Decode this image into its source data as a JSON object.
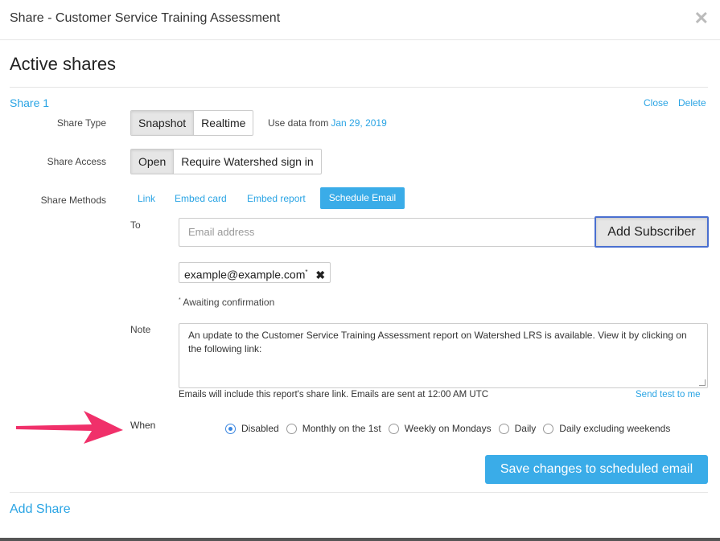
{
  "modal": {
    "title": "Share - Customer Service Training Assessment",
    "close_glyph": "✕"
  },
  "section_title": "Active shares",
  "share": {
    "name": "Share 1",
    "close_label": "Close",
    "delete_label": "Delete",
    "share_type": {
      "label": "Share Type",
      "options": [
        "Snapshot",
        "Realtime"
      ],
      "selected": "Snapshot",
      "date_prefix": "Use data from",
      "date_value": "Jan 29, 2019"
    },
    "share_access": {
      "label": "Share Access",
      "options": [
        "Open",
        "Require Watershed sign in"
      ],
      "selected": "Open"
    },
    "share_methods": {
      "label": "Share Methods",
      "items": [
        "Link",
        "Embed card",
        "Embed report",
        "Schedule Email"
      ],
      "active": "Schedule Email"
    },
    "to": {
      "label": "To",
      "placeholder": "Email address",
      "add_button": "Add Subscriber",
      "subscriber": "example@example.com",
      "subscriber_mark": "*",
      "awaiting_mark": "*",
      "awaiting_text": "Awaiting confirmation"
    },
    "note": {
      "label": "Note",
      "text": "An update to the Customer Service Training Assessment report on Watershed LRS is available. View it by clicking on the following link:",
      "footer": "Emails will include this report's share link. Emails are sent at 12:00 AM UTC",
      "send_test": "Send test to me"
    },
    "when": {
      "label": "When",
      "options": [
        "Disabled",
        "Monthly on the 1st",
        "Weekly on Mondays",
        "Daily",
        "Daily excluding weekends"
      ],
      "selected": "Disabled"
    },
    "save_button": "Save changes to scheduled email"
  },
  "add_share": "Add Share",
  "colors": {
    "accent": "#3aace8",
    "link": "#2aa4e4",
    "arrow": "#f0306a"
  }
}
